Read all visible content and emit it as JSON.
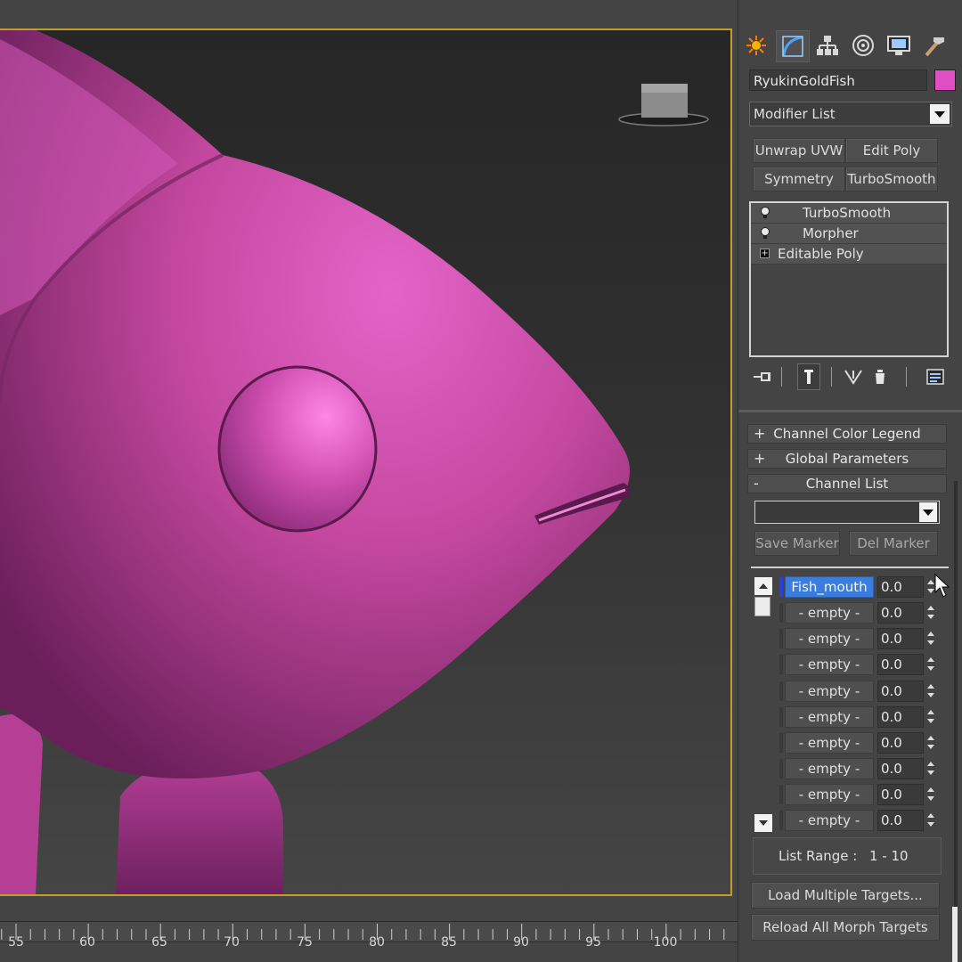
{
  "viewport": {
    "object_color": "#c44aa8"
  },
  "timeline": {
    "ticks": [
      "55",
      "60",
      "65",
      "70",
      "75",
      "80",
      "85",
      "90",
      "95",
      "100"
    ]
  },
  "panel": {
    "tabs": [
      {
        "icon": "create-icon"
      },
      {
        "icon": "modify-icon"
      },
      {
        "icon": "hierarchy-icon"
      },
      {
        "icon": "motion-icon"
      },
      {
        "icon": "display-icon"
      },
      {
        "icon": "utilities-icon"
      }
    ],
    "object_name": "RyukinGoldFish",
    "object_color": "#e04ec4",
    "modifier_list": "Modifier List",
    "quick_buttons": [
      "Unwrap UVW",
      "Edit Poly",
      "Symmetry",
      "TurboSmooth"
    ],
    "stack": [
      {
        "label": "TurboSmooth",
        "type": "modifier"
      },
      {
        "label": "Morpher",
        "type": "modifier"
      },
      {
        "label": "Editable Poly",
        "type": "base"
      }
    ],
    "rollouts": [
      {
        "sign": "+",
        "label": "Channel Color Legend"
      },
      {
        "sign": "+",
        "label": "Global Parameters"
      },
      {
        "sign": "-",
        "label": "Channel List"
      }
    ],
    "marker_dropdown": "",
    "save_marker": "Save Marker",
    "del_marker": "Del Marker",
    "channels": [
      {
        "name": "Fish_mouth",
        "value": "0.0",
        "active": true
      },
      {
        "name": "- empty -",
        "value": "0.0",
        "active": false
      },
      {
        "name": "- empty -",
        "value": "0.0",
        "active": false
      },
      {
        "name": "- empty -",
        "value": "0.0",
        "active": false
      },
      {
        "name": "- empty -",
        "value": "0.0",
        "active": false
      },
      {
        "name": "- empty -",
        "value": "0.0",
        "active": false
      },
      {
        "name": "- empty -",
        "value": "0.0",
        "active": false
      },
      {
        "name": "- empty -",
        "value": "0.0",
        "active": false
      },
      {
        "name": "- empty -",
        "value": "0.0",
        "active": false
      },
      {
        "name": "- empty -",
        "value": "0.0",
        "active": false
      }
    ],
    "list_range_label": "List Range :",
    "list_range_value": "1 - 10",
    "load_multiple": "Load Multiple Targets...",
    "reload_all": "Reload All Morph Targets"
  }
}
